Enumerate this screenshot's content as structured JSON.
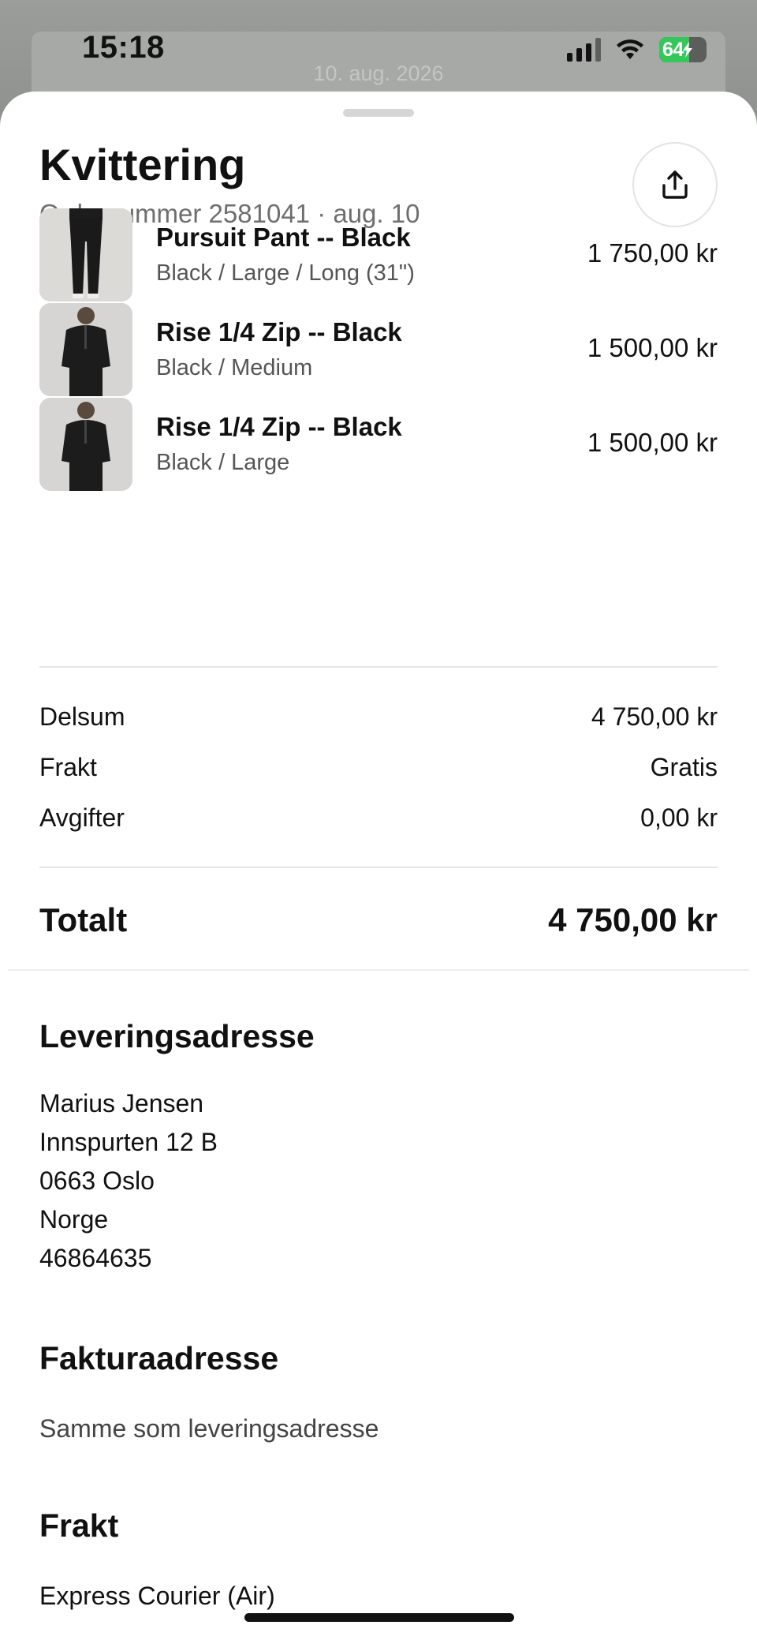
{
  "status_bar": {
    "time": "15:18",
    "battery": "64"
  },
  "backdrop": {
    "date": "10. aug. 2026"
  },
  "receipt": {
    "title": "Kvittering",
    "subtitle": "Ordrenummer 2581041 · aug. 10",
    "share_icon": "share-upload-icon",
    "items": [
      {
        "name": "Pursuit Pant -- Black",
        "variant": "Black / Large / Long (31\")",
        "price": "1 750,00 kr"
      },
      {
        "name": "Rise 1/4 Zip -- Black",
        "variant": "Black / Medium",
        "price": "1 500,00 kr"
      },
      {
        "name": "Rise 1/4 Zip -- Black",
        "variant": "Black / Large",
        "price": "1 500,00 kr"
      }
    ],
    "summary": [
      {
        "label": "Delsum",
        "value": "4 750,00 kr"
      },
      {
        "label": "Frakt",
        "value": "Gratis"
      },
      {
        "label": "Avgifter",
        "value": "0,00 kr"
      }
    ],
    "total": {
      "label": "Totalt",
      "value": "4 750,00 kr"
    }
  },
  "delivery": {
    "heading": "Leveringsadresse",
    "lines": [
      "Marius Jensen",
      "Innspurten 12 B",
      "0663 Oslo",
      "Norge",
      "46864635"
    ]
  },
  "billing": {
    "heading": "Fakturaadresse",
    "text": "Samme som leveringsadresse"
  },
  "shipping": {
    "heading": "Frakt",
    "method": "Express Courier (Air)"
  },
  "colors": {
    "accent": "#34c759",
    "text": "#111111",
    "muted": "#6e6e6e",
    "divider": "#e6e6e6"
  }
}
